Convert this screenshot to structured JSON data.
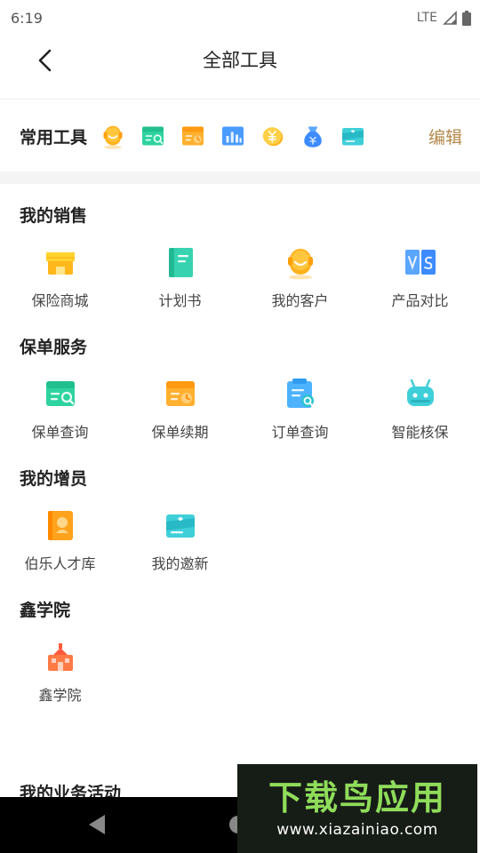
{
  "status": {
    "time": "6:19",
    "network": "LTE"
  },
  "header": {
    "title": "全部工具"
  },
  "common": {
    "label": "常用工具",
    "edit": "编辑",
    "icons": [
      "customer-icon",
      "policy-search-icon",
      "renewal-icon",
      "report-chart-icon",
      "coin-icon",
      "money-bag-icon",
      "invite-icon"
    ]
  },
  "sections": [
    {
      "title": "我的销售",
      "items": [
        {
          "label": "保险商城",
          "icon": "mall-icon"
        },
        {
          "label": "计划书",
          "icon": "plan-book-icon"
        },
        {
          "label": "我的客户",
          "icon": "customer-icon"
        },
        {
          "label": "产品对比",
          "icon": "compare-icon"
        }
      ]
    },
    {
      "title": "保单服务",
      "items": [
        {
          "label": "保单查询",
          "icon": "policy-search-icon"
        },
        {
          "label": "保单续期",
          "icon": "renewal-icon"
        },
        {
          "label": "订单查询",
          "icon": "order-search-icon"
        },
        {
          "label": "智能核保",
          "icon": "robot-icon"
        }
      ]
    },
    {
      "title": "我的增员",
      "items": [
        {
          "label": "伯乐人才库",
          "icon": "talent-icon"
        },
        {
          "label": "我的邀新",
          "icon": "invite-icon"
        }
      ]
    },
    {
      "title": "鑫学院",
      "items": [
        {
          "label": "鑫学院",
          "icon": "academy-icon"
        }
      ]
    }
  ],
  "cut_section": {
    "title": "我的业务活动"
  },
  "watermark": {
    "brand": "下载鸟应用",
    "url": "www.xiazainiao.com"
  }
}
